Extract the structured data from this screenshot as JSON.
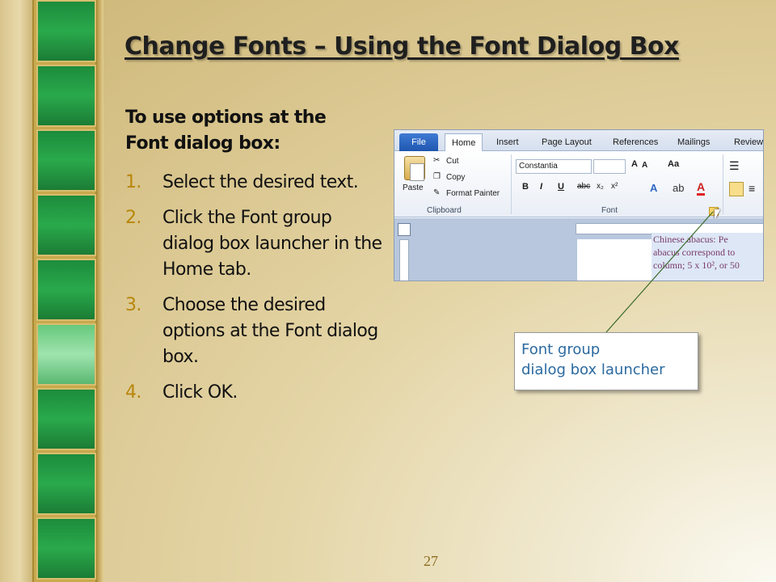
{
  "slide": {
    "title": "Change Fonts – Using the Font Dialog Box",
    "lead": "To use options at the Font dialog box:",
    "steps": [
      {
        "num": "1.",
        "text": "Select the desired text."
      },
      {
        "num": "2.",
        "text": "Click the Font group dialog box launcher in the Home tab."
      },
      {
        "num": "3.",
        "text": "Choose the desired options at the Font dialog box."
      },
      {
        "num": "4.",
        "text": "Click OK."
      }
    ],
    "page_number": "27"
  },
  "ribbon": {
    "tabs": [
      "File",
      "Home",
      "Insert",
      "Page Layout",
      "References",
      "Mailings",
      "Review"
    ],
    "active_tab": "Home",
    "clipboard": {
      "paste": "Paste",
      "cut": "Cut",
      "copy": "Copy",
      "format_painter": "Format Painter",
      "label": "Clipboard"
    },
    "font": {
      "font_name": "Constantia",
      "font_size": "",
      "label": "Font",
      "bold": "B",
      "italic": "I",
      "underline": "U",
      "strikethrough": "abc",
      "subscript": "x₂",
      "superscript": "x²",
      "change_case": "Aa",
      "grow": "A",
      "shrink": "A"
    },
    "document_text": [
      "Chinese abacus: Pe",
      "abacus correspond to",
      "column; 5 x 10², or 50"
    ]
  },
  "callout": {
    "line1": "Font group",
    "line2": "dialog box launcher"
  },
  "colors": {
    "accent": "#b8860b",
    "strip_green": "#2aa94c",
    "callout_text": "#2b6aa0"
  }
}
